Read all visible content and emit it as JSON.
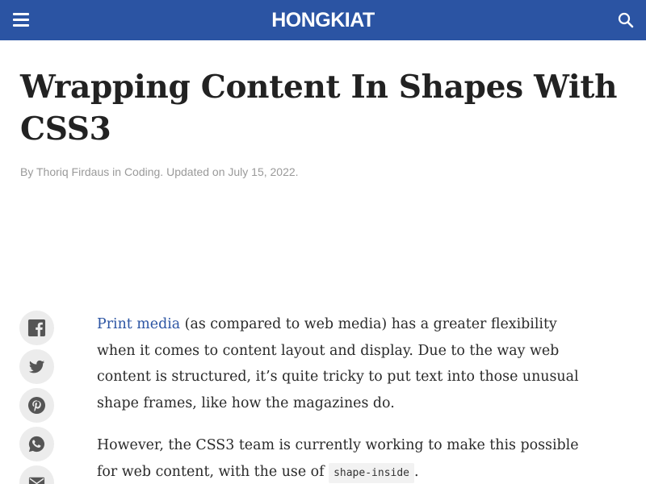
{
  "header": {
    "logo_text": "HONGKIAT",
    "menu_icon": "hamburger-menu-icon",
    "search_icon": "search-icon",
    "background_color": "#2b54a3"
  },
  "article": {
    "title": "Wrapping Content In Shapes With CSS3",
    "byline": {
      "prefix": "By",
      "author": "Thoriq Firdaus",
      "in_word": "in",
      "category": "Coding.",
      "updated_text": "Updated on July 15, 2022."
    },
    "paragraph1": {
      "link_text": "Print media",
      "rest": " (as compared to web media) has a greater flexibility when it comes to content layout and display. Due to the way web content is structured, it’s quite tricky to put text into those unusual shape frames, like how the magazines do."
    },
    "paragraph2": {
      "before": "However, the CSS3 team is currently working to make this possible for web content, with the use of ",
      "code": "shape-inside",
      "after": "."
    },
    "link_color": "#2b54a3"
  },
  "share_bar": {
    "items": [
      {
        "icon": "facebook-icon"
      },
      {
        "icon": "twitter-icon"
      },
      {
        "icon": "pinterest-icon"
      },
      {
        "icon": "whatsapp-icon"
      },
      {
        "icon": "email-icon"
      }
    ]
  }
}
